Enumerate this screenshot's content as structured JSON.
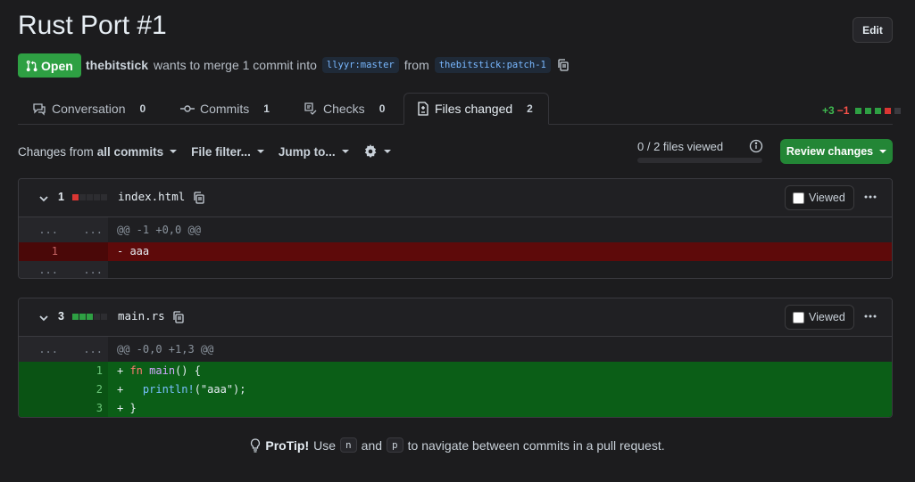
{
  "pr": {
    "title": "Rust Port #1",
    "edit_label": "Edit",
    "state": "Open",
    "author": "thebitstick",
    "merge_text": "wants to merge 1 commit into",
    "base_branch": "llyyr:master",
    "from_text": "from",
    "head_branch": "thebitstick:patch-1"
  },
  "tabs": [
    {
      "label": "Conversation",
      "count": "0",
      "icon": "comment-icon"
    },
    {
      "label": "Commits",
      "count": "1",
      "icon": "commit-icon"
    },
    {
      "label": "Checks",
      "count": "0",
      "icon": "checklist-icon"
    },
    {
      "label": "Files changed",
      "count": "2",
      "icon": "file-diff-icon",
      "active": true
    }
  ],
  "diffstat": {
    "additions": "+3",
    "deletions": "−1"
  },
  "toolbar": {
    "changes_from_prefix": "Changes from",
    "changes_from_value": "all commits",
    "file_filter": "File filter...",
    "jump_to": "Jump to...",
    "files_viewed": "0 / 2 files viewed",
    "review_button": "Review changes"
  },
  "files": [
    {
      "count": "1",
      "name": "index.html",
      "viewed_label": "Viewed",
      "hunk": "@@ -1 +0,0 @@",
      "lines": [
        {
          "old": "1",
          "new": "",
          "type": "del",
          "text": "- aaa"
        }
      ]
    },
    {
      "count": "3",
      "name": "main.rs",
      "viewed_label": "Viewed",
      "hunk": "@@ -0,0 +1,3 @@",
      "lines": [
        {
          "old": "",
          "new": "1",
          "type": "add",
          "text": "+ fn main() {"
        },
        {
          "old": "",
          "new": "2",
          "type": "add",
          "text": "+   println!(\"aaa\");"
        },
        {
          "old": "",
          "new": "3",
          "type": "add",
          "text": "+ }"
        }
      ]
    }
  ],
  "expand_marker": "...",
  "protip": {
    "label": "ProTip!",
    "use": "Use",
    "key1": "n",
    "and": "and",
    "key2": "p",
    "rest": "to navigate between commits in a pull request."
  },
  "colors": {
    "add": "#2ea043",
    "del": "#da3633",
    "neutral": "#3a3a3f",
    "accent": "#238636"
  }
}
